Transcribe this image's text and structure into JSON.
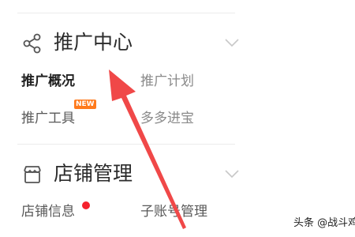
{
  "promotion": {
    "title": "推广中心",
    "icon": "share-icon",
    "items": {
      "overview": "推广概况",
      "plan": "推广计划",
      "tools": "推广工具",
      "tools_badge": "NEW",
      "duoduo": "多多进宝"
    }
  },
  "store": {
    "title": "店铺管理",
    "icon": "store-icon",
    "items": {
      "info": "店铺信息",
      "sub_account": "子账号管理"
    }
  },
  "watermark": "头条 @战斗鸡",
  "colors": {
    "badge": "#ff7a1c",
    "notification_dot": "#f5222d",
    "arrow": "#f04848"
  }
}
